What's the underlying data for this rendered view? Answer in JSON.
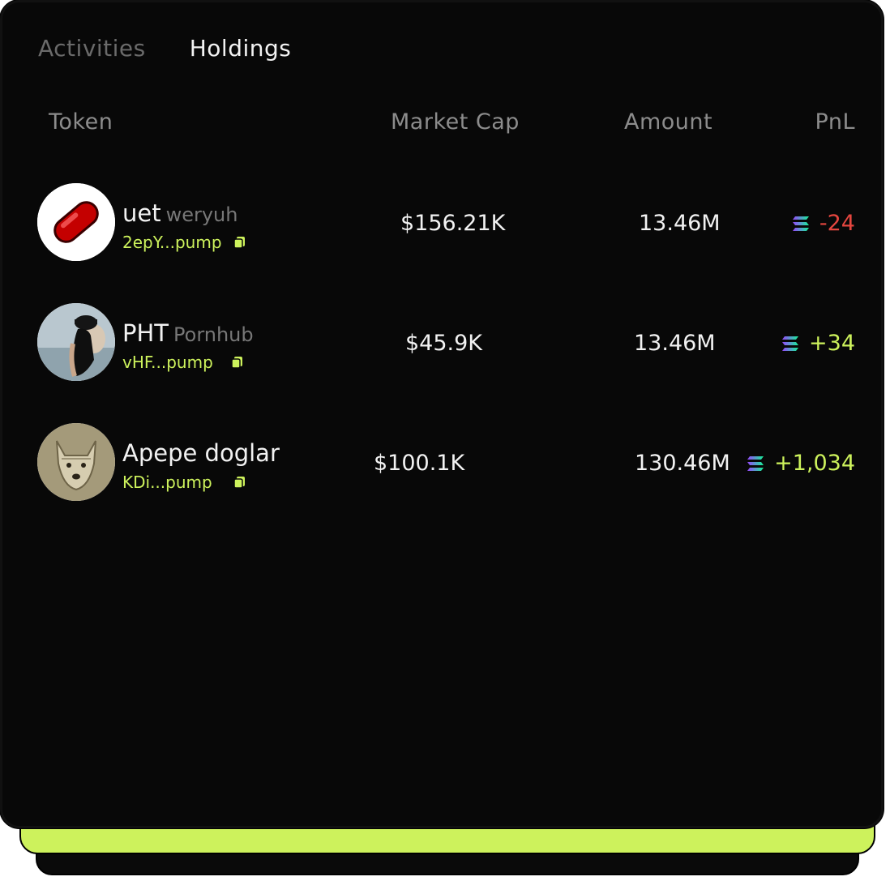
{
  "tabs": [
    {
      "label": "Activities",
      "active": false
    },
    {
      "label": "Holdings",
      "active": true
    }
  ],
  "columns": {
    "token": "Token",
    "market_cap": "Market Cap",
    "amount": "Amount",
    "pnl": "PnL"
  },
  "rows": [
    {
      "symbol": "uet",
      "name": "weryuh",
      "address": "2epY...pump",
      "market_cap": "$156.21K",
      "amount": "13.46M",
      "pnl": "-24",
      "pnl_color": "#e5463f",
      "avatar_icon": "red-pill-icon"
    },
    {
      "symbol": "PHT",
      "name": "Pornhub",
      "address": "vHF...pump",
      "market_cap": "$45.9K",
      "amount": "13.46M",
      "pnl": "+34",
      "pnl_color": "#cdf25c",
      "avatar_icon": "person-photo-icon"
    },
    {
      "symbol": "Apepe doglar",
      "name": "",
      "address": "KDi...pump",
      "market_cap": "$100.1K",
      "amount": "130.46M",
      "pnl": "+1,034",
      "pnl_color": "#cdf25c",
      "avatar_icon": "dog-photo-icon"
    }
  ],
  "colors": {
    "accent": "#cdf25c",
    "negative": "#e5463f",
    "background": "#080808"
  }
}
